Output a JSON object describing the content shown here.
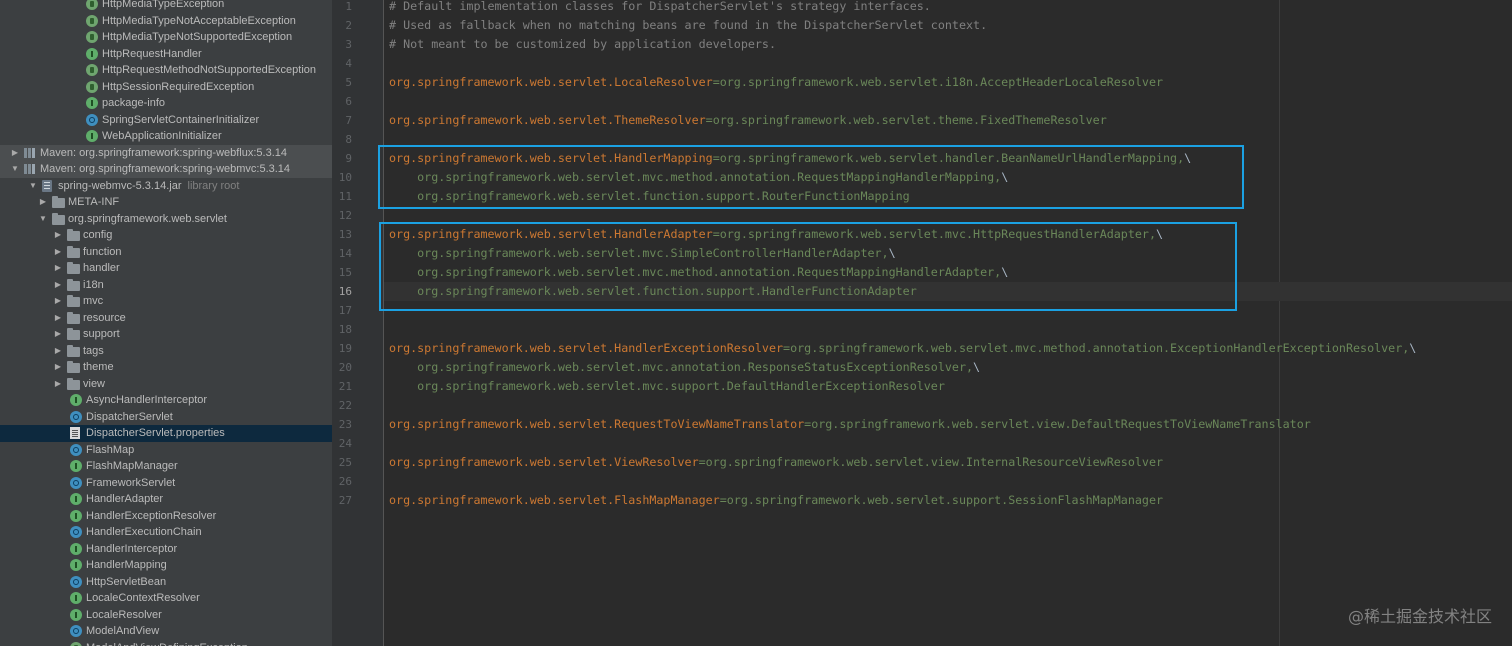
{
  "tree": [
    {
      "label": "HttpMediaTypeException",
      "icon": "exception-icon",
      "level": 5
    },
    {
      "label": "HttpMediaTypeNotAcceptableException",
      "icon": "exception-icon",
      "level": 5
    },
    {
      "label": "HttpMediaTypeNotSupportedException",
      "icon": "exception-icon",
      "level": 5
    },
    {
      "label": "HttpRequestHandler",
      "icon": "interface-icon",
      "level": 5
    },
    {
      "label": "HttpRequestMethodNotSupportedException",
      "icon": "exception-icon",
      "level": 5
    },
    {
      "label": "HttpSessionRequiredException",
      "icon": "exception-icon",
      "level": 5
    },
    {
      "label": "package-info",
      "icon": "interface-icon",
      "level": 5
    },
    {
      "label": "SpringServletContainerInitializer",
      "icon": "class-icon",
      "level": 5
    },
    {
      "label": "WebApplicationInitializer",
      "icon": "interface-icon",
      "level": 5
    },
    {
      "label": "Maven: org.springframework:spring-webflux:5.3.14",
      "icon": "library-icon",
      "level": 0,
      "arrow": "collapsed",
      "grey": true
    },
    {
      "label": "Maven: org.springframework:spring-webmvc:5.3.14",
      "icon": "library-icon",
      "level": 0,
      "arrow": "expanded",
      "grey": true
    },
    {
      "label": "spring-webmvc-5.3.14.jar",
      "suffix": "library root",
      "icon": "jar-icon",
      "level": 1,
      "arrow": "expanded"
    },
    {
      "label": "META-INF",
      "icon": "folder-icon",
      "level": 2,
      "arrow": "collapsed"
    },
    {
      "label": "org.springframework.web.servlet",
      "icon": "folder-icon",
      "level": 2,
      "arrow": "expanded"
    },
    {
      "label": "config",
      "icon": "folder-icon",
      "level": 3,
      "arrow": "collapsed"
    },
    {
      "label": "function",
      "icon": "folder-icon",
      "level": 3,
      "arrow": "collapsed"
    },
    {
      "label": "handler",
      "icon": "folder-icon",
      "level": 3,
      "arrow": "collapsed"
    },
    {
      "label": "i18n",
      "icon": "folder-icon",
      "level": 3,
      "arrow": "collapsed"
    },
    {
      "label": "mvc",
      "icon": "folder-icon",
      "level": 3,
      "arrow": "collapsed"
    },
    {
      "label": "resource",
      "icon": "folder-icon",
      "level": 3,
      "arrow": "collapsed"
    },
    {
      "label": "support",
      "icon": "folder-icon",
      "level": 3,
      "arrow": "collapsed"
    },
    {
      "label": "tags",
      "icon": "folder-icon",
      "level": 3,
      "arrow": "collapsed"
    },
    {
      "label": "theme",
      "icon": "folder-icon",
      "level": 3,
      "arrow": "collapsed"
    },
    {
      "label": "view",
      "icon": "folder-icon",
      "level": 3,
      "arrow": "collapsed"
    },
    {
      "label": "AsyncHandlerInterceptor",
      "icon": "interface-icon",
      "level": 4
    },
    {
      "label": "DispatcherServlet",
      "icon": "class-icon",
      "level": 4
    },
    {
      "label": "DispatcherServlet.properties",
      "icon": "properties-file-icon",
      "level": 4,
      "selected": true
    },
    {
      "label": "FlashMap",
      "icon": "class-icon",
      "level": 4
    },
    {
      "label": "FlashMapManager",
      "icon": "interface-icon",
      "level": 4
    },
    {
      "label": "FrameworkServlet",
      "icon": "class-icon",
      "level": 4
    },
    {
      "label": "HandlerAdapter",
      "icon": "interface-icon",
      "level": 4
    },
    {
      "label": "HandlerExceptionResolver",
      "icon": "interface-icon",
      "level": 4
    },
    {
      "label": "HandlerExecutionChain",
      "icon": "class-icon",
      "level": 4
    },
    {
      "label": "HandlerInterceptor",
      "icon": "interface-icon",
      "level": 4
    },
    {
      "label": "HandlerMapping",
      "icon": "interface-icon",
      "level": 4
    },
    {
      "label": "HttpServletBean",
      "icon": "class-icon",
      "level": 4
    },
    {
      "label": "LocaleContextResolver",
      "icon": "interface-icon",
      "level": 4
    },
    {
      "label": "LocaleResolver",
      "icon": "interface-icon",
      "level": 4
    },
    {
      "label": "ModelAndView",
      "icon": "class-icon",
      "level": 4
    },
    {
      "label": "ModelAndViewDefiningException",
      "icon": "exception-icon",
      "level": 4
    }
  ],
  "editor": {
    "current_line": 16,
    "lines": [
      {
        "n": "1",
        "type": "comment",
        "text": "# Default implementation classes for DispatcherServlet's strategy interfaces."
      },
      {
        "n": "2",
        "type": "comment",
        "text": "# Used as fallback when no matching beans are found in the DispatcherServlet context."
      },
      {
        "n": "3",
        "type": "comment",
        "text": "# Not meant to be customized by application developers."
      },
      {
        "n": "4",
        "type": "blank",
        "text": ""
      },
      {
        "n": "5",
        "type": "prop",
        "key": "org.springframework.web.servlet.LocaleResolver",
        "value": "=org.springframework.web.servlet.i18n.AcceptHeaderLocaleResolver",
        "bs": ""
      },
      {
        "n": "6",
        "type": "blank",
        "text": ""
      },
      {
        "n": "7",
        "type": "prop",
        "key": "org.springframework.web.servlet.ThemeResolver",
        "value": "=org.springframework.web.servlet.theme.FixedThemeResolver",
        "bs": ""
      },
      {
        "n": "8",
        "type": "blank",
        "text": ""
      },
      {
        "n": "9",
        "type": "prop",
        "key": "org.springframework.web.servlet.HandlerMapping",
        "value": "=org.springframework.web.servlet.handler.BeanNameUrlHandlerMapping,",
        "bs": "\\"
      },
      {
        "n": "10",
        "type": "cont",
        "text": "    org.springframework.web.servlet.mvc.method.annotation.RequestMappingHandlerMapping,",
        "bs": "\\"
      },
      {
        "n": "11",
        "type": "cont",
        "text": "    org.springframework.web.servlet.function.support.RouterFunctionMapping",
        "bs": ""
      },
      {
        "n": "12",
        "type": "blank",
        "text": ""
      },
      {
        "n": "13",
        "type": "prop",
        "key": "org.springframework.web.servlet.HandlerAdapter",
        "value": "=org.springframework.web.servlet.mvc.HttpRequestHandlerAdapter,",
        "bs": "\\"
      },
      {
        "n": "14",
        "type": "cont",
        "text": "    org.springframework.web.servlet.mvc.SimpleControllerHandlerAdapter,",
        "bs": "\\"
      },
      {
        "n": "15",
        "type": "cont",
        "text": "    org.springframework.web.servlet.mvc.method.annotation.RequestMappingHandlerAdapter,",
        "bs": "\\"
      },
      {
        "n": "16",
        "type": "cont",
        "text": "    org.springframework.web.servlet.function.support.HandlerFunctionAdapter",
        "bs": ""
      },
      {
        "n": "17",
        "type": "blank",
        "text": ""
      },
      {
        "n": "18",
        "type": "blank",
        "text": ""
      },
      {
        "n": "19",
        "type": "prop",
        "key": "org.springframework.web.servlet.HandlerExceptionResolver",
        "value": "=org.springframework.web.servlet.mvc.method.annotation.ExceptionHandlerExceptionResolver,",
        "bs": "\\"
      },
      {
        "n": "20",
        "type": "cont",
        "text": "    org.springframework.web.servlet.mvc.annotation.ResponseStatusExceptionResolver,",
        "bs": "\\"
      },
      {
        "n": "21",
        "type": "cont",
        "text": "    org.springframework.web.servlet.mvc.support.DefaultHandlerExceptionResolver",
        "bs": ""
      },
      {
        "n": "22",
        "type": "blank",
        "text": ""
      },
      {
        "n": "23",
        "type": "prop",
        "key": "org.springframework.web.servlet.RequestToViewNameTranslator",
        "value": "=org.springframework.web.servlet.view.DefaultRequestToViewNameTranslator",
        "bs": ""
      },
      {
        "n": "24",
        "type": "blank",
        "text": ""
      },
      {
        "n": "25",
        "type": "prop",
        "key": "org.springframework.web.servlet.ViewResolver",
        "value": "=org.springframework.web.servlet.view.InternalResourceViewResolver",
        "bs": ""
      },
      {
        "n": "26",
        "type": "blank",
        "text": ""
      },
      {
        "n": "27",
        "type": "prop",
        "key": "org.springframework.web.servlet.FlashMapManager",
        "value": "=org.springframework.web.servlet.support.SessionFlashMapManager",
        "bs": ""
      }
    ]
  },
  "watermark": "@稀土掘金技术社区",
  "colors": {
    "highlight_box": "#1ba1e2",
    "property_key": "#cc7832",
    "property_value": "#6a8759",
    "comment": "#808080"
  }
}
